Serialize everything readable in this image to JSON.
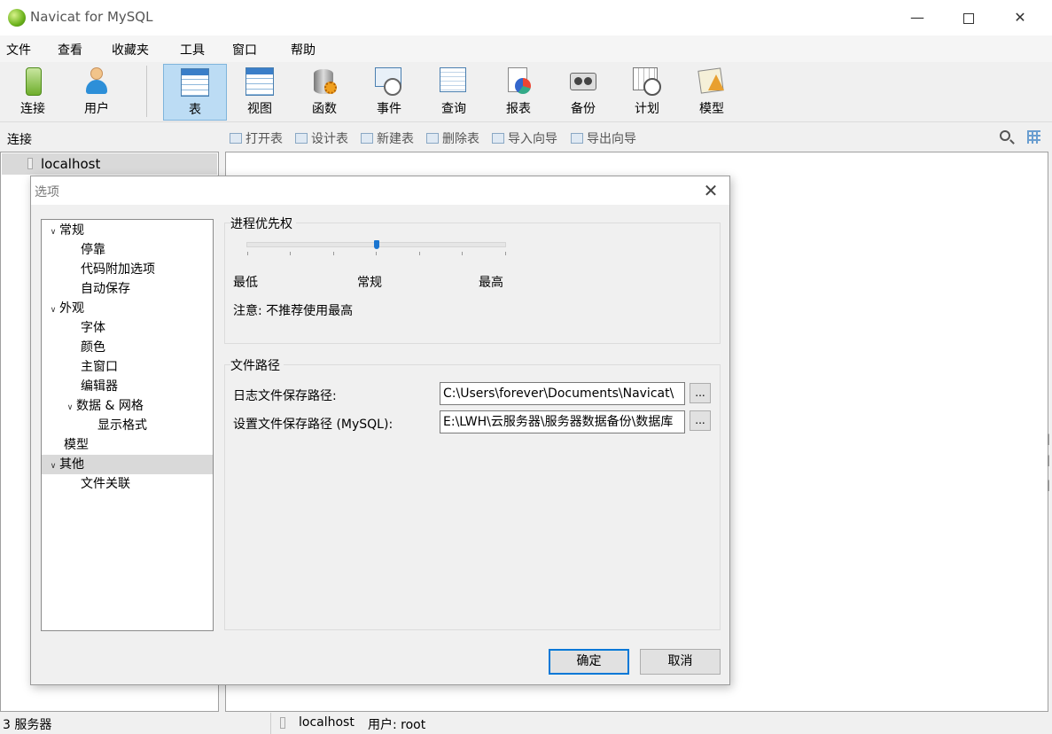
{
  "window": {
    "title": "Navicat for MySQL"
  },
  "menu": [
    "文件",
    "查看",
    "收藏夹",
    "工具",
    "窗口",
    "帮助"
  ],
  "toolbar": {
    "items": [
      {
        "label": "连接",
        "icon": "connection-icon"
      },
      {
        "label": "用户",
        "icon": "user-icon"
      },
      {
        "label": "表",
        "icon": "table-icon",
        "active": true
      },
      {
        "label": "视图",
        "icon": "view-icon"
      },
      {
        "label": "函数",
        "icon": "function-icon"
      },
      {
        "label": "事件",
        "icon": "event-icon"
      },
      {
        "label": "查询",
        "icon": "query-icon"
      },
      {
        "label": "报表",
        "icon": "report-icon"
      },
      {
        "label": "备份",
        "icon": "backup-icon"
      },
      {
        "label": "计划",
        "icon": "schedule-icon"
      },
      {
        "label": "模型",
        "icon": "model-icon"
      }
    ]
  },
  "subbar": {
    "connection_label": "连接",
    "actions": [
      "打开表",
      "设计表",
      "新建表",
      "删除表",
      "导入向导",
      "导出向导"
    ]
  },
  "nav": {
    "host": "localhost"
  },
  "status": {
    "servers": "3 服务器",
    "host": "localhost",
    "user": "用户: root"
  },
  "dialog": {
    "title": "选项",
    "tree": [
      {
        "label": "常规",
        "level": 0,
        "expanded": true
      },
      {
        "label": "停靠",
        "level": 1
      },
      {
        "label": "代码附加选项",
        "level": 1
      },
      {
        "label": "自动保存",
        "level": 1
      },
      {
        "label": "外观",
        "level": 0,
        "expanded": true
      },
      {
        "label": "字体",
        "level": 1
      },
      {
        "label": "颜色",
        "level": 1
      },
      {
        "label": "主窗口",
        "level": 1
      },
      {
        "label": "编辑器",
        "level": 1
      },
      {
        "label": "数据 & 网格",
        "level": 1,
        "expanded": true
      },
      {
        "label": "显示格式",
        "level": 2
      },
      {
        "label": "模型",
        "level": 0
      },
      {
        "label": "其他",
        "level": 0,
        "expanded": true,
        "selected": true
      },
      {
        "label": "文件关联",
        "level": 1
      }
    ],
    "priority": {
      "group_label": "进程优先权",
      "min_label": "最低",
      "mid_label": "常规",
      "max_label": "最高",
      "level": 0.5,
      "note": "注意: 不推荐使用最高"
    },
    "paths": {
      "group_label": "文件路径",
      "log_label": "日志文件保存路径:",
      "log_value": "C:\\Users\\forever\\Documents\\Navicat\\",
      "settings_label": "设置文件保存路径 (MySQL):",
      "settings_value": "E:\\LWH\\云服务器\\服务器数据备份\\数据库",
      "browse_label": "..."
    },
    "ok_label": "确定",
    "cancel_label": "取消"
  }
}
